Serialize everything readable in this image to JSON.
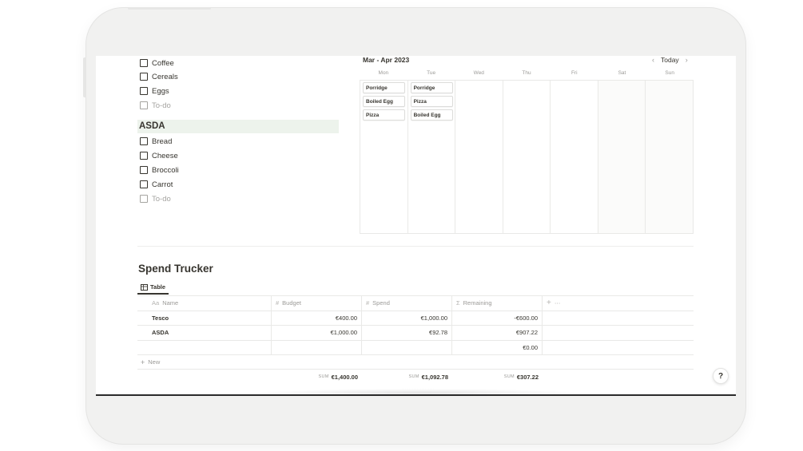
{
  "grocery": {
    "top_items": [
      {
        "label": "Coffee"
      },
      {
        "label": "Cereals"
      },
      {
        "label": "Eggs"
      }
    ],
    "top_placeholder": "To-do",
    "section_title": "ASDA",
    "asda_items": [
      {
        "label": "Bread"
      },
      {
        "label": "Cheese"
      },
      {
        "label": "Broccoli"
      },
      {
        "label": "Carrot"
      }
    ],
    "asda_placeholder": "To-do"
  },
  "calendar": {
    "title": "Mar - Apr 2023",
    "today_label": "Today",
    "days": [
      "Mon",
      "Tue",
      "Wed",
      "Thu",
      "Fri",
      "Sat",
      "Sun"
    ],
    "mon_cards": [
      "Porridge",
      "Boiled Egg",
      "Pizza"
    ],
    "tue_cards": [
      "Porridge",
      "Pizza",
      "Boiled Egg"
    ]
  },
  "spend": {
    "title": "Spend Trucker",
    "view_label": "Table",
    "columns": {
      "name": "Name",
      "name_icon": "Aa",
      "budget": "Budget",
      "spend": "Spend",
      "remaining": "Remaining",
      "number_icon": "#",
      "formula_icon": "Σ"
    },
    "rows": [
      {
        "name": "Tesco",
        "budget": "€400.00",
        "spend": "€1,000.00",
        "remaining": "-€600.00"
      },
      {
        "name": "ASDA",
        "budget": "€1,000.00",
        "spend": "€92.78",
        "remaining": "€907.22"
      },
      {
        "name": "",
        "budget": "",
        "spend": "",
        "remaining": "€0.00"
      }
    ],
    "new_label": "New",
    "sum_label": "SUM",
    "sums": {
      "budget": "€1,400.00",
      "spend": "€1,092.78",
      "remaining": "€307.22"
    }
  },
  "help_label": "?"
}
